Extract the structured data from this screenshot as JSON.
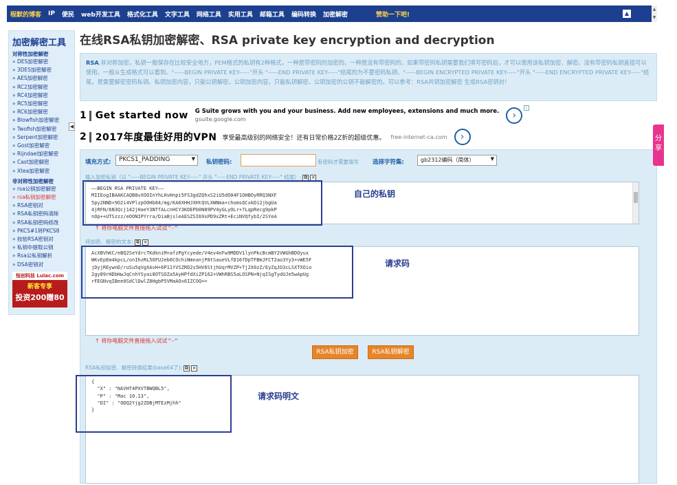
{
  "topnav": {
    "items": [
      "程默的博客",
      "IP",
      "便民",
      "web开发工具",
      "格式化工具",
      "文字工具",
      "网络工具",
      "实用工具",
      "邮箱工具",
      "编码转换",
      "加密解密"
    ],
    "donate": "赞助一下吧!",
    "toggle_icon": "▲"
  },
  "sidebar": {
    "title": "加密解密工具",
    "sym_heading": "对称性加密解密",
    "sym_items": [
      "» DES加密解密",
      "» 3DES加密解密",
      "» AES加密解密",
      "» RC2加密解密",
      "» RC4加密解密",
      "» RC5加密解密",
      "» RC6加密解密",
      "» Blowfish加密解密",
      "» Twofish加密解密",
      "» Serpent加密解密",
      "» Gost加密解密",
      "» Rijndael加密解密",
      "» Cast加密解密",
      "» Xtea加密解密"
    ],
    "asym_heading": "非对称性加密解密",
    "asym_items": [
      "» rsa公钥加密解密",
      "» rsa私钥加密解密",
      "» RSA密钥对",
      "» RSA私钥密码清除",
      "» RSA私钥密码修改",
      "» PKCS#1转PKCS8",
      "» 校验RSA密钥对",
      "» 私钥中提取公钥",
      "» Rsa公私钥解析",
      "» DSA密钥对"
    ],
    "ad": {
      "top": "恒创科技 Lulac.com",
      "mid": "新客专享",
      "bot": "投资200赠80"
    }
  },
  "page": {
    "title": "在线RSA私钥加密解密、RSA private key encryption and decryption",
    "notice_brand": "RSA",
    "notice_text": ",非对称加密，私钥一般保存在比较安全地方，PEM格式的私钥有2种格式，一种是带密码的加密的，一种是没有带密码的。如果带密码私钥需要我们填写密码后，才可以使用该私钥加密、解密。没有带密码私钥直接可以使用。一般从生成格式可以看到。\"-----BEGIN PRIVATE KEY-----\"开头 \"-----END PRIVATE KEY-----\"结尾的为不要密码私钥。\"-----BEGIN ENCRYPTED PRIVATE KEY-----\"开头 \"-----END ENCRYPTED PRIVATE KEY-----\"结尾，是需要解密密码私钥。私钥加密内容，只能公钥解密，公钥加密内容，只能私钥解密。公钥加密的公钥不能解密的。可以参考：RSA共钥加密解密 生成RSA密钥对！"
  },
  "ads": {
    "row1": {
      "num": "1",
      "big": "Get started now",
      "small": "G Suite grows with you and your business. Add new employees, extensions and much more.",
      "sub": "gsuite.google.com",
      "go": "›"
    },
    "row2": {
      "num": "2",
      "big": "2017年度最佳好用的VPN",
      "mid": "享受最高级别的网络安全！还有日常价格2Z折的超级优惠。",
      "grey": "free-internet-ca.com",
      "go": "›"
    },
    "info_icon": "i"
  },
  "form": {
    "padding_label": "填充方式:",
    "padding_value": "PKCS1_PADDING",
    "password_label": "私钥密码:",
    "password_value": "",
    "password_hint": "有密码才需要填写",
    "charset_label": "选择字符集:",
    "charset_value": "gb2312编码（简体）",
    "key_label": "输入加密私钥（以 \"-----BEGIN PRIVATE KEY-----\" 开头 \"-----END PRIVATE KEY-----\" 结尾）:",
    "private_key": "——BEGIN RSA PRIVATE KEY——\nMIIEogIBAAKCAQB8vXOOInYhLHvHnpi5FS3gdZQhxS2iU5dO04F1OHBOyRRQ3NXF\n5py2NND×9O2i4VPlzpOOHb84/mg/KA6XHHJXHtQVLXWNma+chomsQCxkDi2jbgUa\n4jRFN/6N3Qcj142jHaeY3NTfALcnHCY3KDEPb0N89PV4yGLyOLr+7LqpRecg9pkP\nnOp++UTSzzz/eOONIPYrra/DiaBjsleAESZSI69sPD9xZRt+EciNVQfybI/2SYeA",
    "drag_hint_1": "↑ 将你电脑文件直接拖入试试^-^",
    "input_label": "待加密、解密的文本:",
    "input_text": "AcXBVhKC/eBQ2SeYdrcTKdkniM+afzPgYcyede/V4ev4nFw9MDDV1lynPkcBcmBY2VWGhBDOyux\nWKvEpEm4kpcL/onIhzRL5OFUJeb0COchiNmnanjP8tSaueVLfD16fDpTFBmJFCT2ao3Yy3+vWE5F\njDyjREywnD/ruSu5qVgXAvH+6P11YVSZRD2s5HV6StjhUqrMVZP+Tj2X0zZ/EyZqJO3cLSXTXOio\n2gy89rHDbHwJqCnhYSyai8OTSOZa5AyHPfdXiZP162+VWhRBS5aLOSPN+NjqISgTydUJe5wApUg\nrFEGNvqIBee0SdClDwlZ8HgbP5VMaAOx6IZCOQ==",
    "drag_hint_2": "↑ 将你电脑文件直接拖入试试^-^",
    "encrypt_btn": "RSA私钥加密",
    "decrypt_btn": "RSA私钥解密",
    "output_label": "RSA私钥加密、解密转换结果(base64了):",
    "output_text": "{\n  \"X\" : \"NAVHT4PXVTBWQBL5\",\n  \"P\" : \"Mac 10.13\",\n  \"DI\" : \"ODQ2Yjg2ZDBjMTEzMjhh\"\n}",
    "copy_icon": "⧉",
    "clear_icon": "×"
  },
  "annotations": {
    "own_key": "自己的私钥",
    "request_code": "请求码",
    "request_plain": "请求码明文"
  },
  "share": "分享"
}
